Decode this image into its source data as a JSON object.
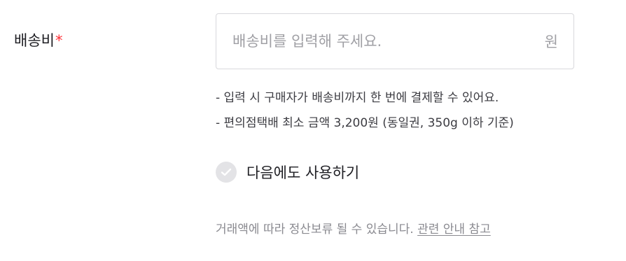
{
  "shipping_fee": {
    "label": "배송비",
    "required_mark": "*",
    "placeholder": "배송비를 입력해 주세요.",
    "value": "",
    "unit": "원",
    "notes": [
      "- 입력 시 구매자가 배송비까지 한 번에 결제할 수 있어요.",
      "- 편의점택배 최소 금액 3,200원 (동일권, 350g 이하 기준)"
    ],
    "reuse_option": {
      "label": "다음에도 사용하기",
      "checked": false,
      "icon": "check-circle-icon"
    },
    "notice": {
      "text": "거래액에 따라 정산보류 될 수 있습니다. ",
      "link_label": "관련 안내 참고"
    }
  },
  "colors": {
    "required": "#ff2e35",
    "border": "#d8d8dc",
    "placeholder": "#a0a0a5",
    "check_background": "#e3e3e6"
  }
}
